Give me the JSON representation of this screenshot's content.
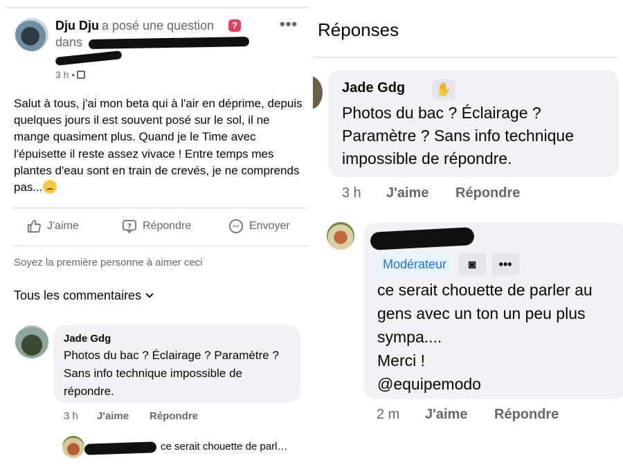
{
  "post": {
    "author": "Dju Dju",
    "asked": "a posé une question",
    "in_label": "dans",
    "time": "3 h •",
    "body": "Salut à tous, j'ai mon beta qui à l'air en déprime, depuis quelques jours il est souvent posé sur le sol, il ne mange quasiment plus. Quand je le Time avec l'épuisette il reste assez vivace ! Entre temps mes plantes d'eau sont en train de crevés, je ne comprends pas...",
    "actions": {
      "like": "J'aime",
      "reply": "Répondre",
      "send": "Envoyer"
    },
    "first_like": "Soyez la première personne à aimer ceci",
    "all_comments": "Tous les commentaires"
  },
  "left_comment": {
    "author": "Jade Gdg",
    "text": "Photos du bac ? Éclairage ? Paramètre ? Sans info technique impossible de répondre.",
    "time": "3 h",
    "like": "J'aime",
    "reply": "Répondre",
    "reply_preview": "ce serait chouette de parl…"
  },
  "replies_panel": {
    "title": "Réponses",
    "comment1": {
      "author": "Jade Gdg",
      "badge_icon": "wave-icon",
      "text": "Photos du bac ? Éclairage ? Paramètre ? Sans info technique impossible de répondre.",
      "time": "3 h",
      "like": "J'aime",
      "reply": "Répondre"
    },
    "comment2": {
      "badge": "Modérateur",
      "more": "•••",
      "text": "ce serait chouette de parler au gens avec un ton un peu plus sympa....\nMerci !\n@equipemodo",
      "time": "2 m",
      "like": "J'aime",
      "reply": "Répondre"
    }
  },
  "colors": {
    "gray_text": "#65676b",
    "bubble": "#f0f2f5",
    "moderator_blue": "#1b74e4"
  }
}
